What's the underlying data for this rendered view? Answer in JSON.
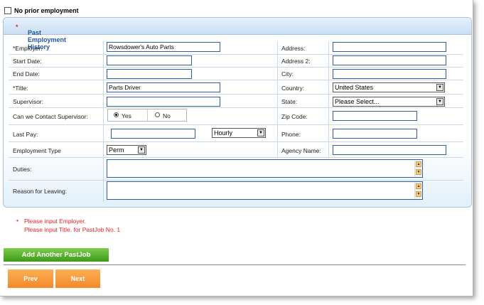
{
  "no_prior_employment": {
    "label": "No prior employment",
    "checked": false
  },
  "panel": {
    "title": "Past Employment History",
    "required_mark": "*"
  },
  "left_labels": {
    "employer": "*Employer:",
    "start_date": "Start Date:",
    "end_date": "End Date:",
    "title": "*Title:",
    "supervisor": "Supervisor:",
    "contact_supervisor": "Can we Contact Supervisor:",
    "last_pay": "Last Pay:",
    "employment_type": "Employment Type",
    "duties": "Duties:",
    "reason_for_leaving": "Reason for Leaving:"
  },
  "right_labels": {
    "address": "Address:",
    "address2": "Address 2:",
    "city": "City:",
    "country": "Country:",
    "state": "State:",
    "zip_code": "Zip Code:",
    "phone": "Phone:",
    "agency_name": "Agency Name:"
  },
  "values": {
    "employer": "Rowsdower's Auto Parts",
    "start_date": "",
    "end_date": "",
    "title": "Parts Driver",
    "supervisor": "",
    "last_pay": "",
    "pay_period": "Hourly",
    "employment_type": "Perm",
    "address": "",
    "address2": "",
    "city": "",
    "country": "United States",
    "state": "Please Select...",
    "zip_code": "",
    "phone": "",
    "agency_name": ""
  },
  "contact_supervisor_options": {
    "yes": "Yes",
    "no": "No",
    "selected": "yes"
  },
  "errors": [
    "Please input Employer.",
    "Please input Title. for PastJob No. 1"
  ],
  "buttons": {
    "add_another": "Add Another PastJob",
    "prev": "Prev",
    "next": "Next"
  },
  "colors": {
    "accent_blue": "#1f57a6",
    "error_red": "#e8232b",
    "green_button": "#3f9a1b",
    "orange_button": "#f2892a"
  }
}
